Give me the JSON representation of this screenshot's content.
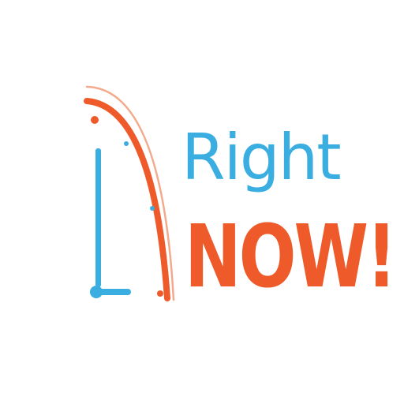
{
  "logo": {
    "line1": "Right",
    "line2": "NOW!"
  },
  "colors": {
    "blue": "#3aaee0",
    "orange": "#ef5a2a",
    "background": "#ffffff"
  },
  "icons": {
    "clock": "clock-icon"
  }
}
